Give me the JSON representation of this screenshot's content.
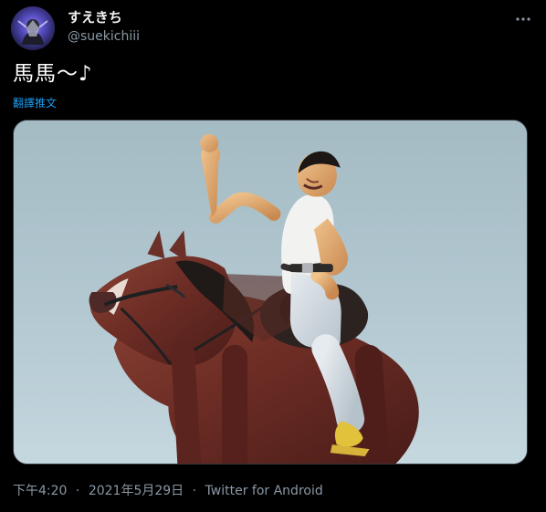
{
  "author": {
    "display_name": "すえきち",
    "handle": "@suekichiii",
    "avatar_icon": "avatar-icon"
  },
  "actions": {
    "more_icon": "more-icon"
  },
  "tweet": {
    "text": "馬馬～♪",
    "translate_label": "翻譯推文"
  },
  "media": {
    "kind": "photo"
  },
  "meta": {
    "time": "下午4:20",
    "separator": "·",
    "date": "2021年5月29日",
    "source": "Twitter for Android"
  },
  "colors": {
    "background": "#000000",
    "text": "#ffffff",
    "secondary_text": "#8b98a5",
    "link": "#1d9bf0",
    "border": "#333639"
  }
}
